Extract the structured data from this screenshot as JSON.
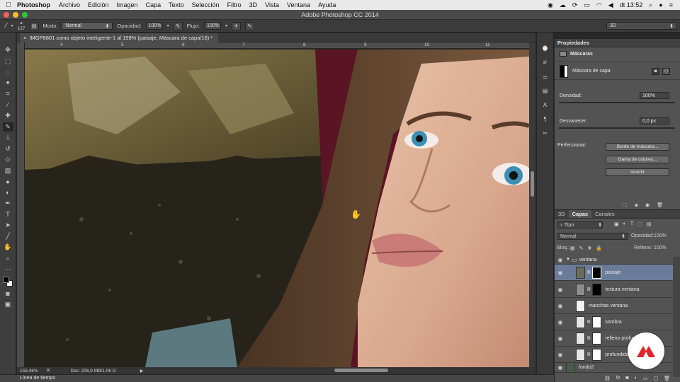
{
  "menubar": {
    "app_name": "Photoshop",
    "items": [
      "Archivo",
      "Edición",
      "Imagen",
      "Capa",
      "Texto",
      "Selección",
      "Filtro",
      "3D",
      "Vista",
      "Ventana",
      "Ayuda"
    ],
    "clock": "dt 13:52"
  },
  "window": {
    "title": "Adobe Photoshop CC 2014"
  },
  "options": {
    "brush_size": "127",
    "mode_label": "Modo:",
    "mode_value": "Normal",
    "opacity_label": "Opacidad:",
    "opacity_value": "100%",
    "flow_label": "Flujo:",
    "flow_value": "100%",
    "workspace_value": "3D"
  },
  "document": {
    "tab_title": "IMGP8801 como objeto inteligente-1 al 159% (paisaje, Máscara de capa/16) *",
    "ruler_ticks": [
      "4",
      "5",
      "6",
      "7",
      "8",
      "9",
      "10",
      "11"
    ],
    "zoom": "159,46%",
    "doc_info": "Doc: 206,9 MB/1,06 G"
  },
  "timeline_label": "Línea de tiempo",
  "properties": {
    "panel_title": "Propiedades",
    "section_title": "Máscaras",
    "mask_type": "Máscara de capa",
    "density_label": "Densidad:",
    "density_value": "100%",
    "feather_label": "Desvanecer:",
    "feather_value": "0,0 px",
    "refine_label": "Perfeccionar:",
    "btn_mask_edge": "Borde de máscara...",
    "btn_color_range": "Gama de colores...",
    "btn_invert": "Invertir"
  },
  "layers": {
    "tabs": [
      "3D",
      "Capas",
      "Canales"
    ],
    "active_tab": "Capas",
    "filter_value": "Tipo",
    "blend_mode": "Normal",
    "opacity_label": "Opacidad:",
    "opacity_value": "100%",
    "lock_label": "Bloq.:",
    "fill_label": "Relleno:",
    "fill_value": "100%",
    "items": [
      {
        "name": "ventana",
        "kind": "group"
      },
      {
        "name": "paisaje",
        "kind": "layer",
        "selected": true
      },
      {
        "name": "textura ventana",
        "kind": "layer"
      },
      {
        "name": "manchas ventana",
        "kind": "layer"
      },
      {
        "name": "sombra",
        "kind": "layer"
      },
      {
        "name": "relleno profun",
        "kind": "layer"
      },
      {
        "name": "profundidad",
        "kind": "layer"
      },
      {
        "name": "fondo2",
        "kind": "layer"
      }
    ]
  },
  "colors": {
    "accent_selected_layer": "#6a7c99",
    "panel_bg": "#535353",
    "brand_badge": "#e0262b"
  }
}
